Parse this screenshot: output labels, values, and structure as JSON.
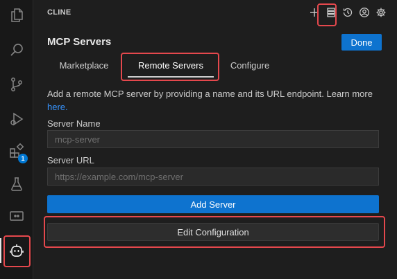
{
  "activity_bar": {
    "items": [
      {
        "icon": "explorer-icon"
      },
      {
        "icon": "search-icon"
      },
      {
        "icon": "source-control-icon"
      },
      {
        "icon": "run-debug-icon"
      },
      {
        "icon": "extensions-icon",
        "badge": "1"
      },
      {
        "icon": "testing-icon"
      },
      {
        "icon": "remote-explorer-icon"
      },
      {
        "icon": "cline-robot-icon",
        "selected": true
      }
    ]
  },
  "header": {
    "title": "CLINE",
    "icons": [
      "plus-icon",
      "mcp-servers-icon",
      "history-icon",
      "account-icon",
      "settings-icon"
    ]
  },
  "main": {
    "title": "MCP Servers",
    "done_label": "Done",
    "tabs": [
      {
        "label": "Marketplace"
      },
      {
        "label": "Remote Servers",
        "active": true
      },
      {
        "label": "Configure"
      }
    ],
    "description_text": "Add a remote MCP server by providing a name and its URL endpoint. Learn more ",
    "description_link": "here.",
    "server_name_label": "Server Name",
    "server_name_placeholder": "mcp-server",
    "server_name_value": "",
    "server_url_label": "Server URL",
    "server_url_placeholder": "https://example.com/mcp-server",
    "server_url_value": "",
    "add_server_label": "Add Server",
    "edit_configuration_label": "Edit Configuration"
  },
  "colors": {
    "accent": "#0e73cf",
    "link": "#3794ff",
    "highlight": "#e5484d",
    "background": "#1e1e1e"
  }
}
